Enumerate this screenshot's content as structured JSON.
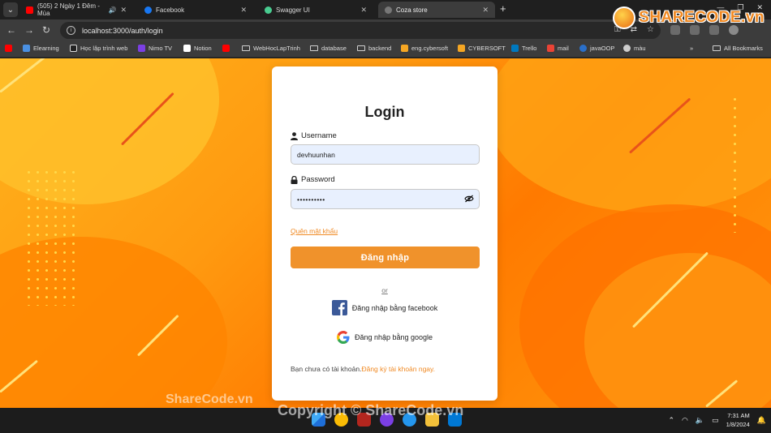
{
  "browser": {
    "tabs": [
      {
        "title": "(505) 2 Ngày 1 Đêm - Mùa",
        "favicon_color": "#ff0000",
        "audio": true
      },
      {
        "title": "Facebook",
        "favicon_color": "#1877f2"
      },
      {
        "title": "Swagger UI",
        "favicon_color": "#49cc90"
      },
      {
        "title": "Coza store",
        "favicon_color": "#777777",
        "active": true
      }
    ],
    "url": "localhost:3000/auth/login",
    "bookmarks": [
      {
        "label": "",
        "icon": "youtube-icon",
        "color": "#ff0000"
      },
      {
        "label": "Elearning",
        "icon": "elearning-icon",
        "color": "#4a90e2"
      },
      {
        "label": "Học lập trình web",
        "icon": "c-icon",
        "color": "#222222"
      },
      {
        "label": "Nimo TV",
        "icon": "nimo-icon",
        "color": "#7b3fe4"
      },
      {
        "label": "Notion",
        "icon": "notion-icon",
        "color": "#ffffff"
      },
      {
        "label": "",
        "icon": "youtube-icon",
        "color": "#ff0000"
      },
      {
        "label": "WebHocLapTrinh",
        "icon": "folder-icon"
      },
      {
        "label": "database",
        "icon": "folder-icon"
      },
      {
        "label": "backend",
        "icon": "folder-icon"
      },
      {
        "label": "eng.cybersoft",
        "icon": "cybersoft-icon",
        "color": "#f5a623"
      },
      {
        "label": "CYBERSOFT",
        "icon": "cybersoft-icon",
        "color": "#f5a623"
      },
      {
        "label": "Trello",
        "icon": "trello-icon",
        "color": "#0079bf"
      },
      {
        "label": "mail",
        "icon": "gmail-icon",
        "color": "#ea4335"
      },
      {
        "label": "javaOOP",
        "icon": "java-icon",
        "color": "#2a6fc9"
      },
      {
        "label": "màu",
        "icon": "globe-icon",
        "color": "#cccccc"
      }
    ],
    "all_bookmarks": "All Bookmarks"
  },
  "login": {
    "title": "Login",
    "username_label": "Username",
    "username_value": "devhuunhan",
    "password_label": "Password",
    "password_value": "••••••••••",
    "forgot_link": "Quên mật khẩu",
    "submit_label": "Đăng nhập",
    "or_label": "or",
    "facebook_label": "Đăng nhập bằng facebook",
    "google_label": "Đăng nhập bằng google",
    "signup_prompt": "Bạn chưa có tài khoản.",
    "signup_link": "Đăng ký tài khoản ngay."
  },
  "watermarks": {
    "logo_text": "SHARECODE.vn",
    "small_text": "ShareCode.vn",
    "copyright_text": "Copyright © ShareCode.vn"
  },
  "taskbar": {
    "time": "7:31 AM",
    "date": "1/8/2024"
  },
  "colors": {
    "accent": "#f0922b",
    "background": "#ff8c0a"
  }
}
